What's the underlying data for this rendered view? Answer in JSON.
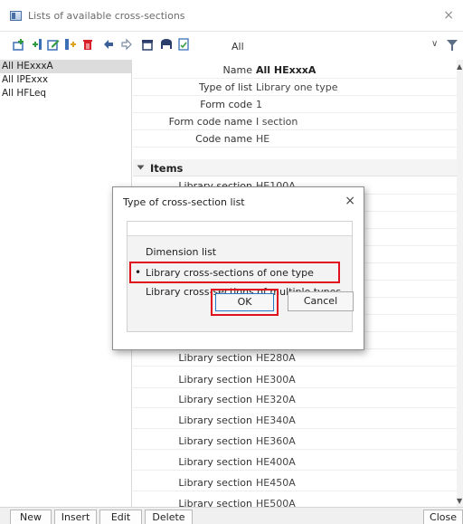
{
  "window": {
    "title": "Lists of available cross-sections",
    "close_icon": "×"
  },
  "toolbar": {
    "icons": [
      "new-row-icon",
      "insert-row-icon",
      "edit-icon",
      "copy-icon",
      "delete-icon",
      "undo-icon",
      "redo-icon",
      "table-icon",
      "save-icon",
      "export-icon"
    ],
    "filter_value": "All",
    "dropdown_icon": "chevron-down-icon",
    "filter_icon": "funnel-icon"
  },
  "lists": [
    {
      "label": "All HExxxA",
      "selected": true
    },
    {
      "label": "All IPExxx",
      "selected": false
    },
    {
      "label": "All HFLeq",
      "selected": false
    }
  ],
  "properties": [
    {
      "label": "Name",
      "value": "All HExxxA",
      "bold": true
    },
    {
      "label": "Type of list",
      "value": "Library one type"
    },
    {
      "label": "Form code",
      "value": "1"
    },
    {
      "label": "Form code name",
      "value": "I section"
    },
    {
      "label": "Code name",
      "value": "HE"
    }
  ],
  "items_section": {
    "label": "Items",
    "rows": [
      {
        "label": "Library section",
        "value": "HE100A"
      },
      {
        "label": "Library section",
        "value": "HE280A"
      },
      {
        "label": "Library section",
        "value": "HE300A"
      },
      {
        "label": "Library section",
        "value": "HE320A"
      },
      {
        "label": "Library section",
        "value": "HE340A"
      },
      {
        "label": "Library section",
        "value": "HE360A"
      },
      {
        "label": "Library section",
        "value": "HE400A"
      },
      {
        "label": "Library section",
        "value": "HE450A"
      },
      {
        "label": "Library section",
        "value": "HE500A"
      }
    ]
  },
  "bottom_buttons": {
    "new": "New",
    "insert": "Insert",
    "edit": "Edit",
    "delete": "Delete",
    "close": "Close"
  },
  "dialog": {
    "title": "Type of cross-section list",
    "close_icon": "×",
    "options": [
      {
        "label": "Dimension list",
        "selected": false
      },
      {
        "label": "Library cross-sections of one type",
        "selected": true
      },
      {
        "label": "Library cross-sections of multiple types",
        "selected": false
      }
    ],
    "ok_label": "OK",
    "cancel_label": "Cancel",
    "highlight_color": "#e0101e"
  }
}
